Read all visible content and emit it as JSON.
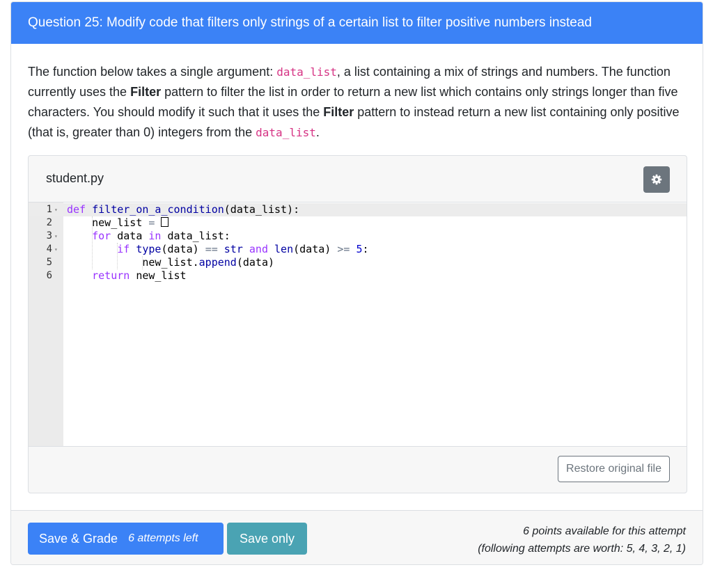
{
  "header": {
    "title": "Question 25: Modify code that filters only strings of a certain list to filter positive numbers instead"
  },
  "prompt": {
    "p1": "The function below takes a single argument: ",
    "code1": "data_list",
    "p2": ", a list containing a mix of strings and numbers. The function currently uses the ",
    "b1": "Filter",
    "p3": " pattern to filter the list in order to return a new list which contains only strings longer than five characters. You should modify it such that it uses the ",
    "b2": "Filter",
    "p4": " pattern to instead return a new list containing only positive (that is, greater than 0) integers from the ",
    "code2": "data_list",
    "p5": "."
  },
  "file": {
    "name": "student.py",
    "settings_icon": "gear-icon",
    "restore_label": "Restore original file"
  },
  "editor": {
    "line_numbers": [
      "1",
      "2",
      "3",
      "4",
      "5",
      "6"
    ],
    "fold_marker": "▾",
    "l1": {
      "kw": "def",
      "fn": "filter_on_a_condition",
      "rest": "(data_list):"
    },
    "l2": {
      "a": "new_list ",
      "op": "=",
      "b": " "
    },
    "l3": {
      "kw": "for",
      "a": " data ",
      "kw2": "in",
      "b": " data_list:"
    },
    "l4": {
      "kw": "if",
      "sp": " ",
      "bi1": "type",
      "a": "(data) ",
      "op1": "==",
      "sp2": " ",
      "bi2": "str",
      "sp3": " ",
      "kw2": "and",
      "sp4": " ",
      "bi3": "len",
      "b": "(data) ",
      "op2": ">=",
      "sp5": " ",
      "num": "5",
      "c": ":"
    },
    "l5": {
      "a": "new_list.",
      "fn": "append",
      "b": "(data)"
    },
    "l6": {
      "kw": "return",
      "a": " new_list"
    }
  },
  "footer": {
    "grade_label": "Save & Grade",
    "attempts_left": "6 attempts left",
    "save_only_label": "Save only",
    "points_line1": "6 points available for this attempt",
    "points_line2": "(following attempts are worth: 5, 4, 3, 2, 1)"
  }
}
